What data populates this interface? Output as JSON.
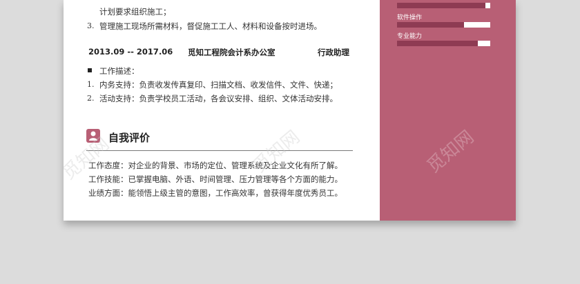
{
  "experience": {
    "lines_top": [
      "计划要求组织施工；",
      "管理施工现场所需材料，督促施工工人、材料和设备按时进场。"
    ],
    "line_top_num": "3.",
    "job": {
      "date": "2013.09 -- 2017.06",
      "company": "觅知工程院会计系办公室",
      "title": "行政助理"
    },
    "desc_label": "工作描述：",
    "items": [
      {
        "num": "1.",
        "text": "内务支持：负责收发传真复印、扫描文档、收发信件、文件、快递；"
      },
      {
        "num": "2.",
        "text": "活动支持：负责学校员工活动，各会议安排、组织、文体活动安排。"
      }
    ]
  },
  "self_eval": {
    "title": "自我评价",
    "lines": [
      "工作态度：对企业的背景、市场的定位、管理系统及企业文化有所了解。",
      "工作技能：已掌握电脑、外语、时间管理、压力管理等各个方面的能力。",
      "业绩方面：能领悟上级主管的意图，工作高效率，曾获得年度优秀员工。"
    ]
  },
  "skills": [
    {
      "label": "",
      "level": 0.05
    },
    {
      "label": "软件操作",
      "level": 0.28
    },
    {
      "label": "专业能力",
      "level": 0.13
    }
  ],
  "watermark": "觅知网",
  "colors": {
    "accent": "#b85f75",
    "bar_bg": "#8e3b53"
  }
}
